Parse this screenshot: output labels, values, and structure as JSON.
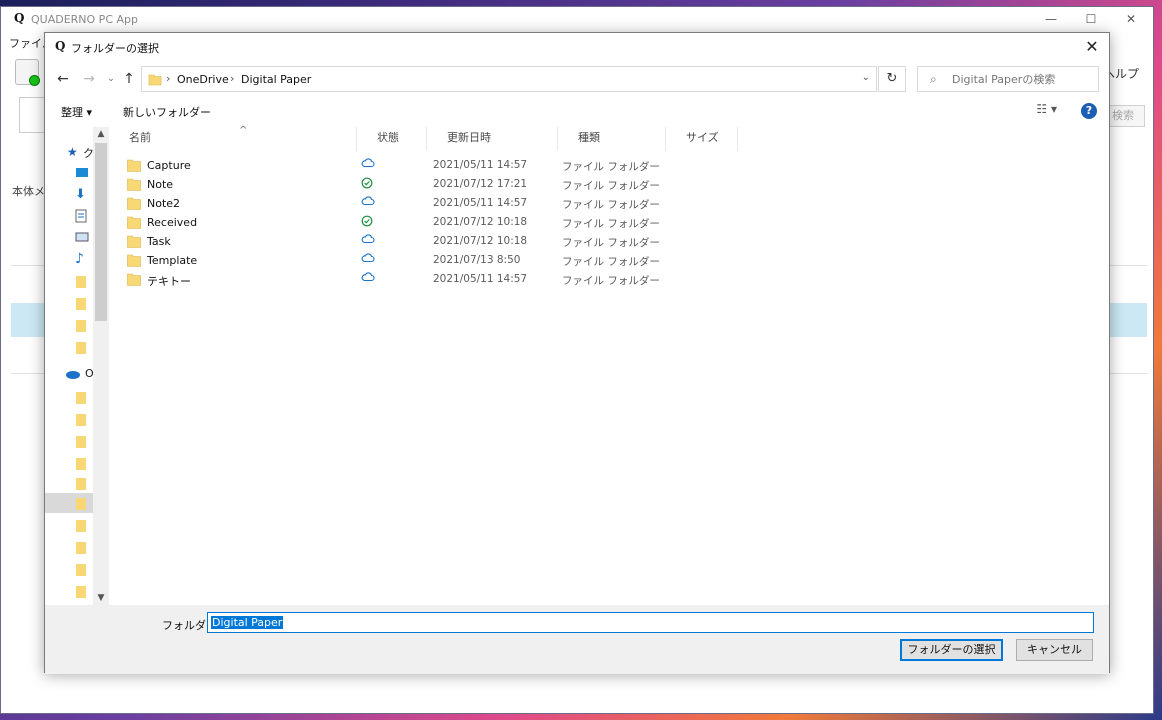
{
  "app": {
    "logo": "Q",
    "title": "QUADERNO PC App",
    "menu_file": "ファイル",
    "help": "ヘルプ",
    "search_btn": "検索",
    "side_label": "本体メ",
    "win_min": "—",
    "win_max": "☐",
    "win_close": "✕"
  },
  "dialog": {
    "logo": "Q",
    "title": "フォルダーの選択",
    "close": "✕",
    "breadcrumb": [
      "OneDrive",
      "Digital Paper"
    ],
    "search_placeholder": "Digital Paperの検索",
    "cmd_organize": "整理 ▾",
    "cmd_new_folder": "新しいフォルダー",
    "help": "?",
    "left_quick_label": "ク",
    "left_onedrive_label": "O",
    "columns": [
      "名前",
      "状態",
      "更新日時",
      "種類",
      "サイズ"
    ],
    "files": [
      {
        "name": "Capture",
        "status": "cloud",
        "date": "2021/05/11 14:57",
        "kind": "ファイル フォルダー"
      },
      {
        "name": "Note",
        "status": "synced",
        "date": "2021/07/12 17:21",
        "kind": "ファイル フォルダー"
      },
      {
        "name": "Note2",
        "status": "cloud",
        "date": "2021/05/11 14:57",
        "kind": "ファイル フォルダー"
      },
      {
        "name": "Received",
        "status": "synced",
        "date": "2021/07/12 10:18",
        "kind": "ファイル フォルダー"
      },
      {
        "name": "Task",
        "status": "cloud",
        "date": "2021/07/12 10:18",
        "kind": "ファイル フォルダー"
      },
      {
        "name": "Template",
        "status": "cloud",
        "date": "2021/07/13 8:50",
        "kind": "ファイル フォルダー"
      },
      {
        "name": "テキトー",
        "status": "cloud",
        "date": "2021/05/11 14:57",
        "kind": "ファイル フォルダー"
      }
    ],
    "folder_label": "フォルダー:",
    "folder_value": "Digital Paper",
    "select_button": "フォルダーの選択",
    "cancel_button": "キャンセル"
  },
  "colors": {
    "accent": "#0078d7",
    "cloud": "#1a73c8",
    "synced": "#1e8e3e",
    "folder": "#f8d775"
  }
}
